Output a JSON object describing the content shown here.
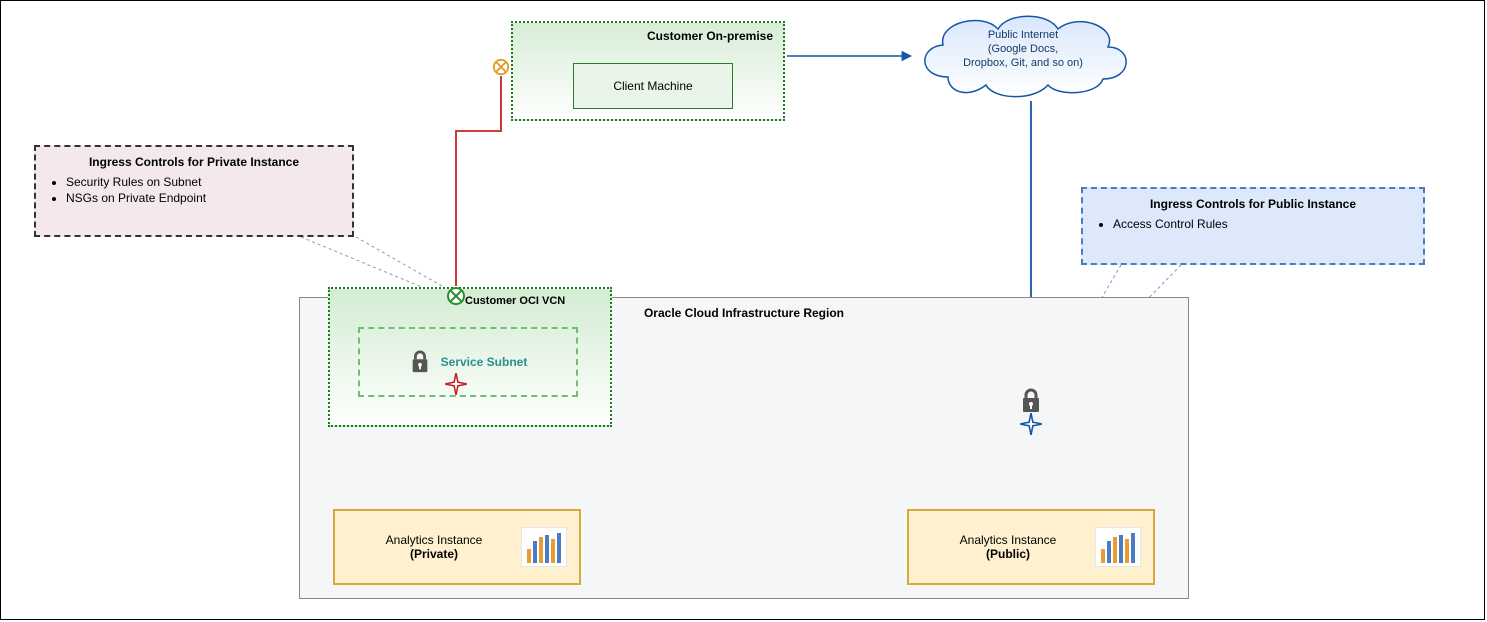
{
  "onprem": {
    "title": "Customer On-premise",
    "client_label": "Client Machine"
  },
  "cloud": {
    "line1": "Public Internet",
    "line2": "(Google Docs,",
    "line3": "Dropbox, Git, and so on)"
  },
  "ingress_private": {
    "title": "Ingress Controls for Private Instance",
    "item1": "Security Rules on Subnet",
    "item2": "NSGs on Private Endpoint"
  },
  "ingress_public": {
    "title": "Ingress Controls for Public Instance",
    "item1": "Access Control Rules"
  },
  "region": {
    "title": "Oracle Cloud Infrastructure Region"
  },
  "vcn": {
    "title": "Customer OCI VCN",
    "subnet_label": "Service Subnet"
  },
  "analytics_private": {
    "label_line1": "Analytics Instance",
    "label_line2": "(Private)"
  },
  "analytics_public": {
    "label_line1": "Analytics Instance",
    "label_line2": "(Public)"
  }
}
